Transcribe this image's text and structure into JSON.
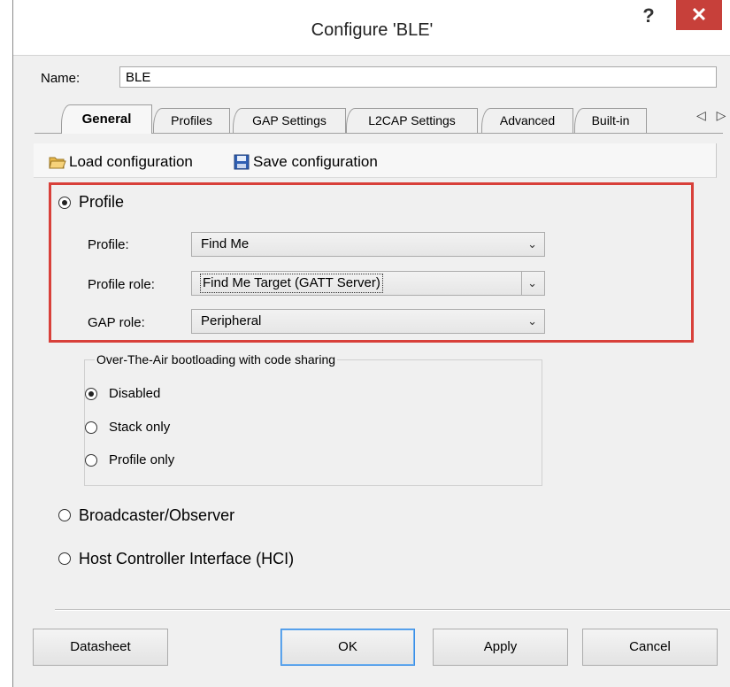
{
  "window": {
    "title": "Configure 'BLE'",
    "help_glyph": "?",
    "close_glyph": "✕"
  },
  "name_row": {
    "label": "Name:",
    "value": "BLE"
  },
  "tabs": [
    {
      "label": "General",
      "active": true
    },
    {
      "label": "Profiles"
    },
    {
      "label": "GAP Settings"
    },
    {
      "label": "L2CAP Settings"
    },
    {
      "label": "Advanced"
    },
    {
      "label": "Built-in"
    }
  ],
  "tab_arrows": "◁ ▷",
  "toolbar": {
    "load_label": "Load configuration",
    "save_label": "Save configuration"
  },
  "profile_mode": {
    "label": "Profile",
    "selected": true,
    "fields": {
      "profile": {
        "label": "Profile:",
        "value": "Find Me"
      },
      "profile_role": {
        "label": "Profile role:",
        "value": "Find Me Target (GATT Server)"
      },
      "gap_role": {
        "label": "GAP role:",
        "value": "Peripheral"
      }
    }
  },
  "ota": {
    "legend": "Over-The-Air bootloading with code sharing",
    "options": [
      {
        "label": "Disabled",
        "selected": true
      },
      {
        "label": "Stack only",
        "selected": false
      },
      {
        "label": "Profile only",
        "selected": false
      }
    ]
  },
  "other_modes": [
    {
      "label": "Broadcaster/Observer",
      "selected": false
    },
    {
      "label": "Host Controller Interface (HCI)",
      "selected": false
    }
  ],
  "buttons": {
    "datasheet": "Datasheet",
    "ok": "OK",
    "apply": "Apply",
    "cancel": "Cancel"
  },
  "colors": {
    "highlight": "#d8403a",
    "close_button": "#c7403a",
    "default_button_border": "#3a8ee6"
  }
}
